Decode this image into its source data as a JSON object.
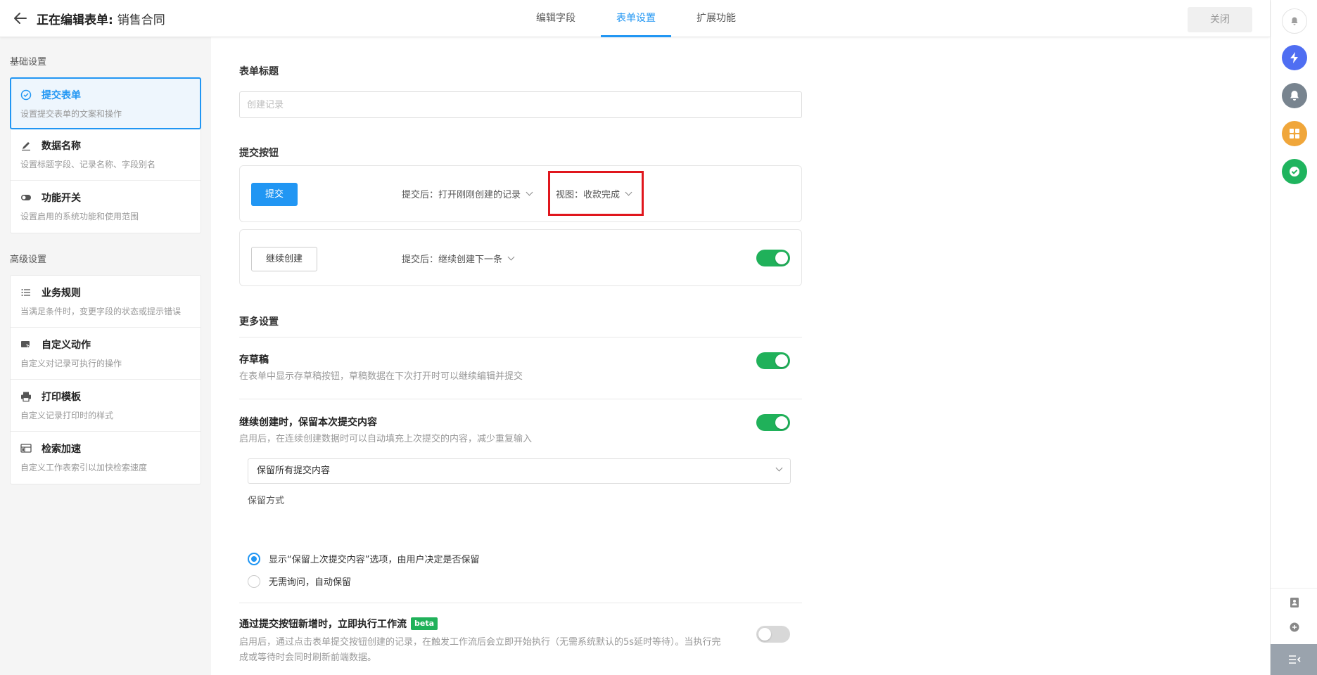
{
  "header": {
    "title_prefix": "正在编辑表单:",
    "form_name": "销售合同",
    "tabs": [
      "编辑字段",
      "表单设置",
      "扩展功能"
    ],
    "active_tab": "表单设置",
    "close_label": "关闭"
  },
  "sidebar": {
    "basic_title": "基础设置",
    "basic_items": [
      {
        "title": "提交表单",
        "desc": "设置提交表单的文案和操作",
        "icon": "check-circle-icon"
      },
      {
        "title": "数据名称",
        "desc": "设置标题字段、记录名称、字段别名",
        "icon": "pencil-icon"
      },
      {
        "title": "功能开关",
        "desc": "设置启用的系统功能和使用范围",
        "icon": "toggle-icon"
      }
    ],
    "advanced_title": "高级设置",
    "advanced_items": [
      {
        "title": "业务规则",
        "desc": "当满足条件时，变更字段的状态或提示错误",
        "icon": "list-icon"
      },
      {
        "title": "自定义动作",
        "desc": "自定义对记录可执行的操作",
        "icon": "action-icon"
      },
      {
        "title": "打印模板",
        "desc": "自定义记录打印时的样式",
        "icon": "printer-icon"
      },
      {
        "title": "检索加速",
        "desc": "自定义工作表索引以加快检索速度",
        "icon": "index-icon"
      }
    ]
  },
  "main": {
    "form_title_label": "表单标题",
    "form_title_placeholder": "创建记录",
    "submit_section_label": "提交按钮",
    "submit_button": {
      "label": "提交",
      "after_action": "提交后：打开刚刚创建的记录",
      "view": "视图：收款完成"
    },
    "continue_button": {
      "label": "继续创建",
      "after_action": "提交后：继续创建下一条",
      "enabled": true
    },
    "more_settings_label": "更多设置",
    "draft": {
      "title": "存草稿",
      "desc": "在表单中显示存草稿按钮，草稿数据在下次打开时可以继续编辑并提交",
      "enabled": true
    },
    "keep_content": {
      "title": "继续创建时，保留本次提交内容",
      "desc": "启用后，在连续创建数据时可以自动填充上次提交的内容，减少重复输入",
      "enabled": true,
      "select_value": "保留所有提交内容",
      "mode_label": "保留方式",
      "options": [
        "显示“保留上次提交内容”选项，由用户决定是否保留",
        "无需询问，自动保留"
      ],
      "selected_option_index": 0
    },
    "workflow": {
      "title": "通过提交按钮新增时，立即执行工作流",
      "badge": "beta",
      "desc_line1": "启用后，通过点击表单提交按钮创建的记录，在触发工作流后会立即开始执行（无需系统默认的5s延时等待）。当执行完",
      "desc_line2": "成或等待时会同时刷新前端数据。",
      "enabled": false
    }
  },
  "rail": {
    "colors": {
      "bell": "#9e9e9e",
      "bolt": "#4f6ef2",
      "notify": "#78848f",
      "grid": "#f0a63a",
      "check": "#1fb45e"
    }
  }
}
